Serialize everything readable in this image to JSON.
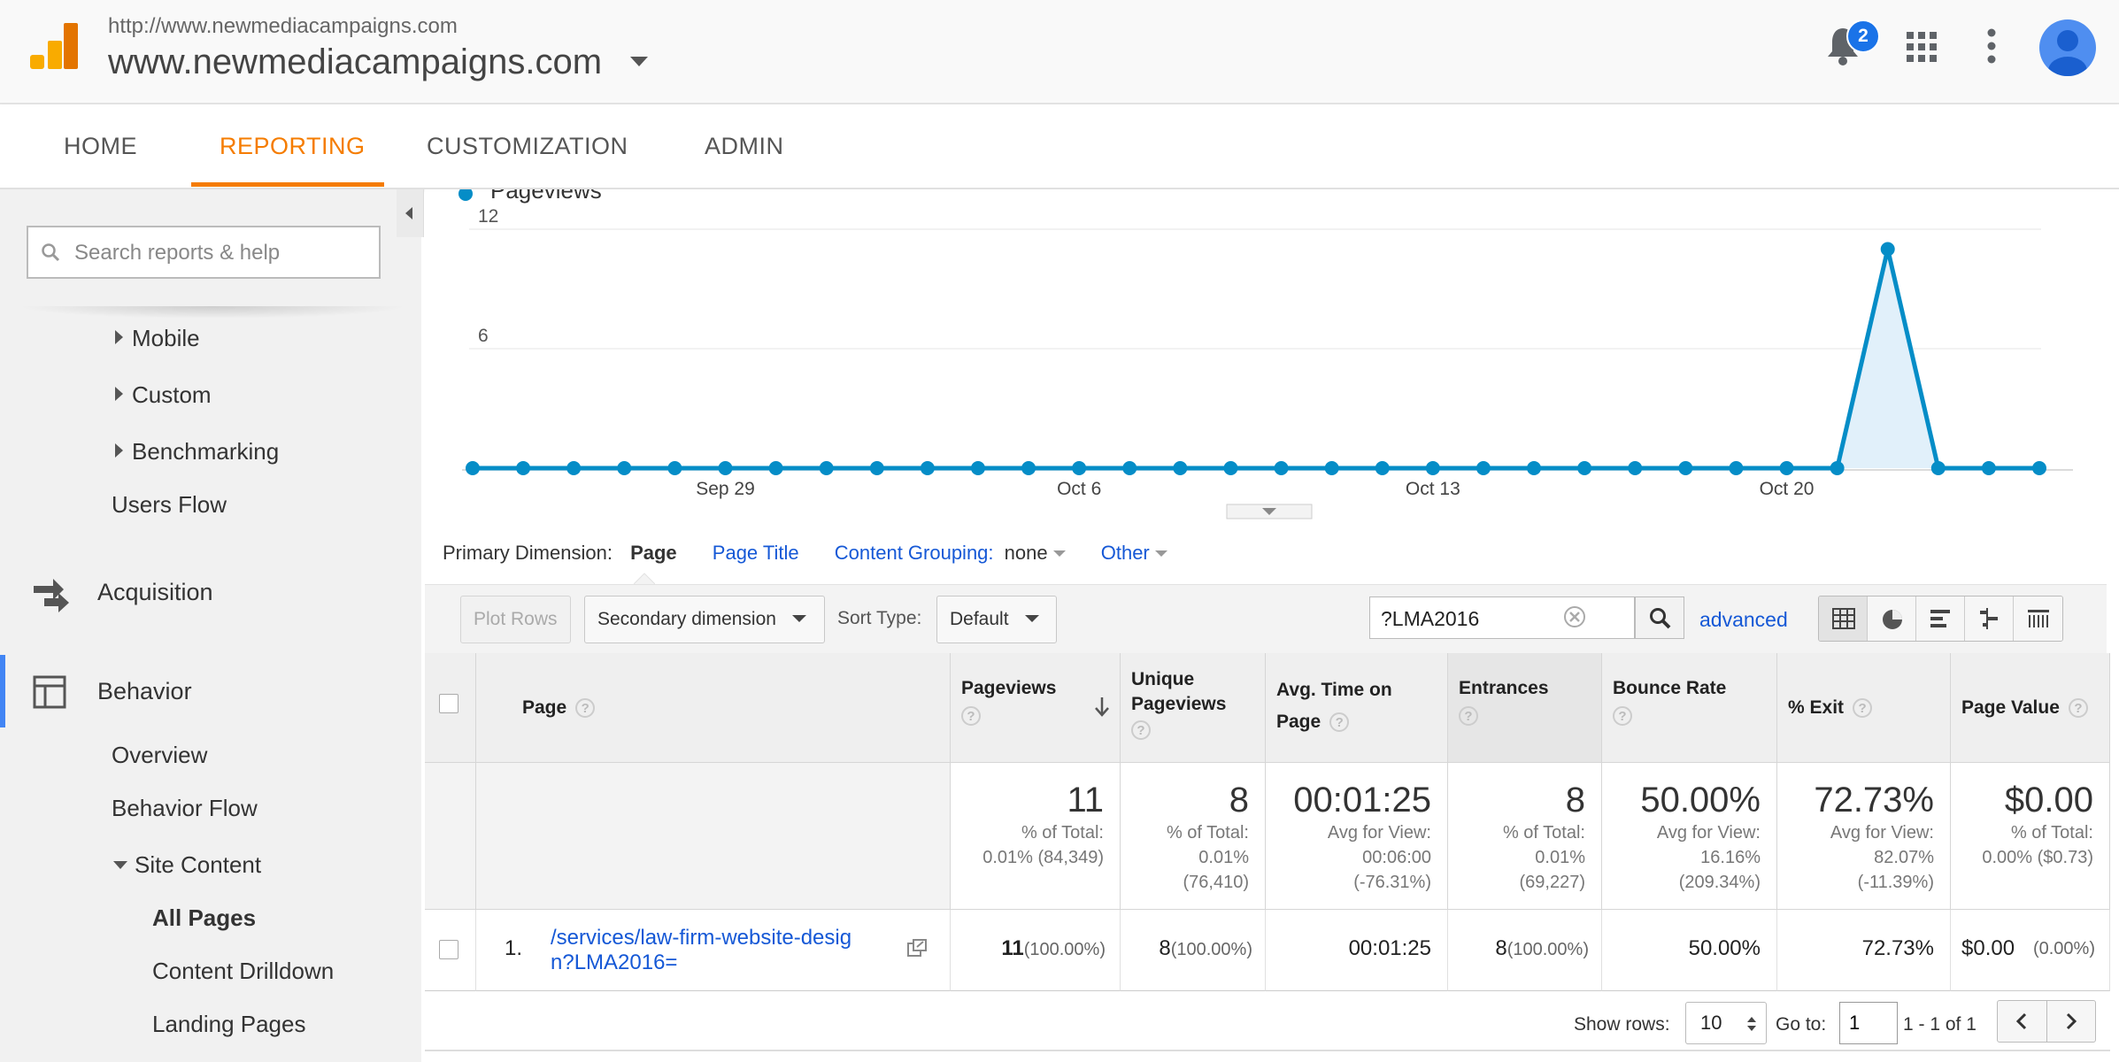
{
  "header": {
    "account_url": "http://www.newmediacampaigns.com",
    "property_name": "www.newmediacampaigns.com",
    "notification_count": "2",
    "icons": [
      "analytics-logo-icon",
      "bell-icon",
      "apps-grid-icon",
      "more-vert-icon",
      "account-avatar-icon"
    ]
  },
  "nav": {
    "tabs": [
      {
        "label": "HOME"
      },
      {
        "label": "REPORTING",
        "active": true
      },
      {
        "label": "CUSTOMIZATION"
      },
      {
        "label": "ADMIN"
      }
    ]
  },
  "sidebar": {
    "search_placeholder": "Search reports & help",
    "items": [
      {
        "label": "Mobile"
      },
      {
        "label": "Custom"
      },
      {
        "label": "Benchmarking"
      },
      {
        "label": "Users Flow"
      }
    ],
    "acquisition": "Acquisition",
    "behavior": "Behavior",
    "behavior_items": [
      {
        "label": "Overview"
      },
      {
        "label": "Behavior Flow"
      },
      {
        "label": "Site Content"
      },
      {
        "label": "All Pages",
        "active": true
      },
      {
        "label": "Content Drilldown"
      },
      {
        "label": "Landing Pages"
      }
    ]
  },
  "chart_legend": "Pageviews",
  "chart_data": {
    "type": "line",
    "series": [
      {
        "name": "Pageviews",
        "values": [
          0,
          0,
          0,
          0,
          0,
          0,
          0,
          0,
          0,
          0,
          0,
          0,
          0,
          0,
          0,
          0,
          0,
          0,
          0,
          0,
          0,
          0,
          0,
          0,
          0,
          0,
          0,
          0,
          11,
          0,
          0,
          0
        ]
      }
    ],
    "x_tick_labels": [
      "Sep 29",
      "Oct 6",
      "Oct 13",
      "Oct 20"
    ],
    "y_tick_labels": [
      "12",
      "6"
    ],
    "ylim": [
      0,
      12
    ],
    "fill": true,
    "color": "#058dc7",
    "grid": true
  },
  "dimensions": {
    "label": "Primary Dimension:",
    "active": "Page",
    "page_title": "Page Title",
    "content_grouping": "Content Grouping:",
    "content_grouping_value": "none",
    "other": "Other"
  },
  "toolbar": {
    "plot_rows": "Plot Rows",
    "secondary_dimension": "Secondary dimension",
    "sort_type_label": "Sort Type:",
    "sort_type_value": "Default",
    "filter_value": "?LMA2016",
    "advanced": "advanced"
  },
  "table": {
    "headers": {
      "page": "Page",
      "pageviews": "Pageviews",
      "unique_pageviews_1": "Unique",
      "unique_pageviews_2": "Pageviews",
      "avg_time_1": "Avg. Time on",
      "avg_time_2": "Page",
      "entrances": "Entrances",
      "bounce_rate": "Bounce Rate",
      "exit": "% Exit",
      "page_value": "Page Value"
    },
    "totals": {
      "pageviews": {
        "big": "11",
        "l1": "% of Total:",
        "l2": "0.01% (84,349)"
      },
      "unique": {
        "big": "8",
        "l1": "% of Total:",
        "l2": "0.01%",
        "l3": "(76,410)"
      },
      "avg_time": {
        "big": "00:01:25",
        "l1": "Avg for View:",
        "l2": "00:06:00",
        "l3": "(-76.31%)"
      },
      "entrances": {
        "big": "8",
        "l1": "% of Total:",
        "l2": "0.01%",
        "l3": "(69,227)"
      },
      "bounce": {
        "big": "50.00%",
        "l1": "Avg for View:",
        "l2": "16.16%",
        "l3": "(209.34%)"
      },
      "exit": {
        "big": "72.73%",
        "l1": "Avg for View:",
        "l2": "82.07%",
        "l3": "(-11.39%)"
      },
      "value": {
        "big": "$0.00",
        "l1": "% of Total:",
        "l2": "0.00% ($0.73)"
      }
    },
    "rows": [
      {
        "index": "1.",
        "page_l1": "/services/law-firm-website-desig",
        "page_l2": "n?LMA2016=",
        "pageviews": "11",
        "pageviews_pct": "(100.00%)",
        "unique": "8",
        "unique_pct": "(100.00%)",
        "avg_time": "00:01:25",
        "entrances": "8",
        "entrances_pct": "(100.00%)",
        "bounce": "50.00%",
        "exit": "72.73%",
        "value": "$0.00",
        "value_pct": "(0.00%)"
      }
    ]
  },
  "pager": {
    "show_rows_label": "Show rows:",
    "rows_value": "10",
    "goto_label": "Go to:",
    "goto_value": "1",
    "range": "1 - 1 of 1"
  }
}
